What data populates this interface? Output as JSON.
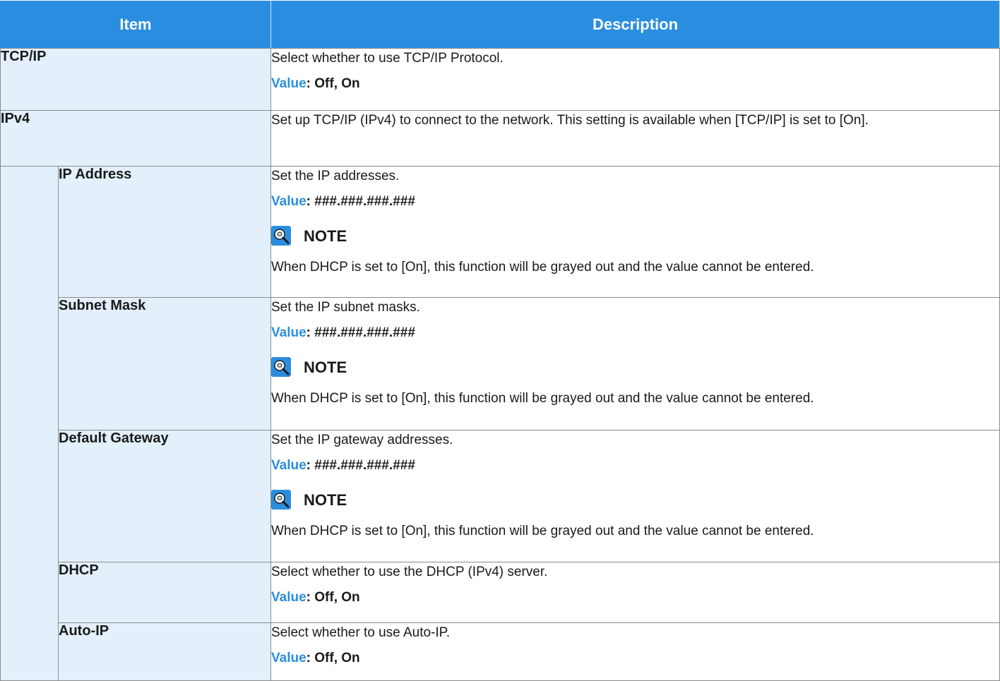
{
  "header": {
    "item": "Item",
    "description": "Description"
  },
  "value_label": "Value",
  "note_title": "NOTE",
  "rows": {
    "tcpip": {
      "name": "TCP/IP",
      "desc": "Select whether to use TCP/IP Protocol.",
      "value": ": Off, On"
    },
    "ipv4": {
      "name": "IPv4",
      "desc": "Set up TCP/IP (IPv4) to connect to the network. This setting is available when [TCP/IP] is set to [On]."
    },
    "ip_address": {
      "name": "IP Address",
      "desc": "Set the IP addresses.",
      "value": ": ###.###.###.###",
      "note": "When DHCP is set to [On], this function will be grayed out and the value cannot be entered."
    },
    "subnet_mask": {
      "name": "Subnet Mask",
      "desc": "Set the IP subnet masks.",
      "value": ": ###.###.###.###",
      "note": "When DHCP is set to [On], this function will be grayed out and the value cannot be entered."
    },
    "default_gateway": {
      "name": "Default Gateway",
      "desc": "Set the IP gateway addresses.",
      "value": ": ###.###.###.###",
      "note": "When DHCP is set to [On], this function will be grayed out and the value cannot be entered."
    },
    "dhcp": {
      "name": "DHCP",
      "desc": "Select whether to use the DHCP (IPv4) server.",
      "value": ": Off, On"
    },
    "auto_ip": {
      "name": "Auto-IP",
      "desc": "Select whether to use Auto-IP.",
      "value": ": Off, On"
    }
  },
  "colors": {
    "header_bg": "#2a8ee0",
    "item_bg": "#e3f0fb",
    "accent": "#2a8ee0"
  },
  "icons": {
    "note": "lightbulb-magnifier-icon"
  }
}
